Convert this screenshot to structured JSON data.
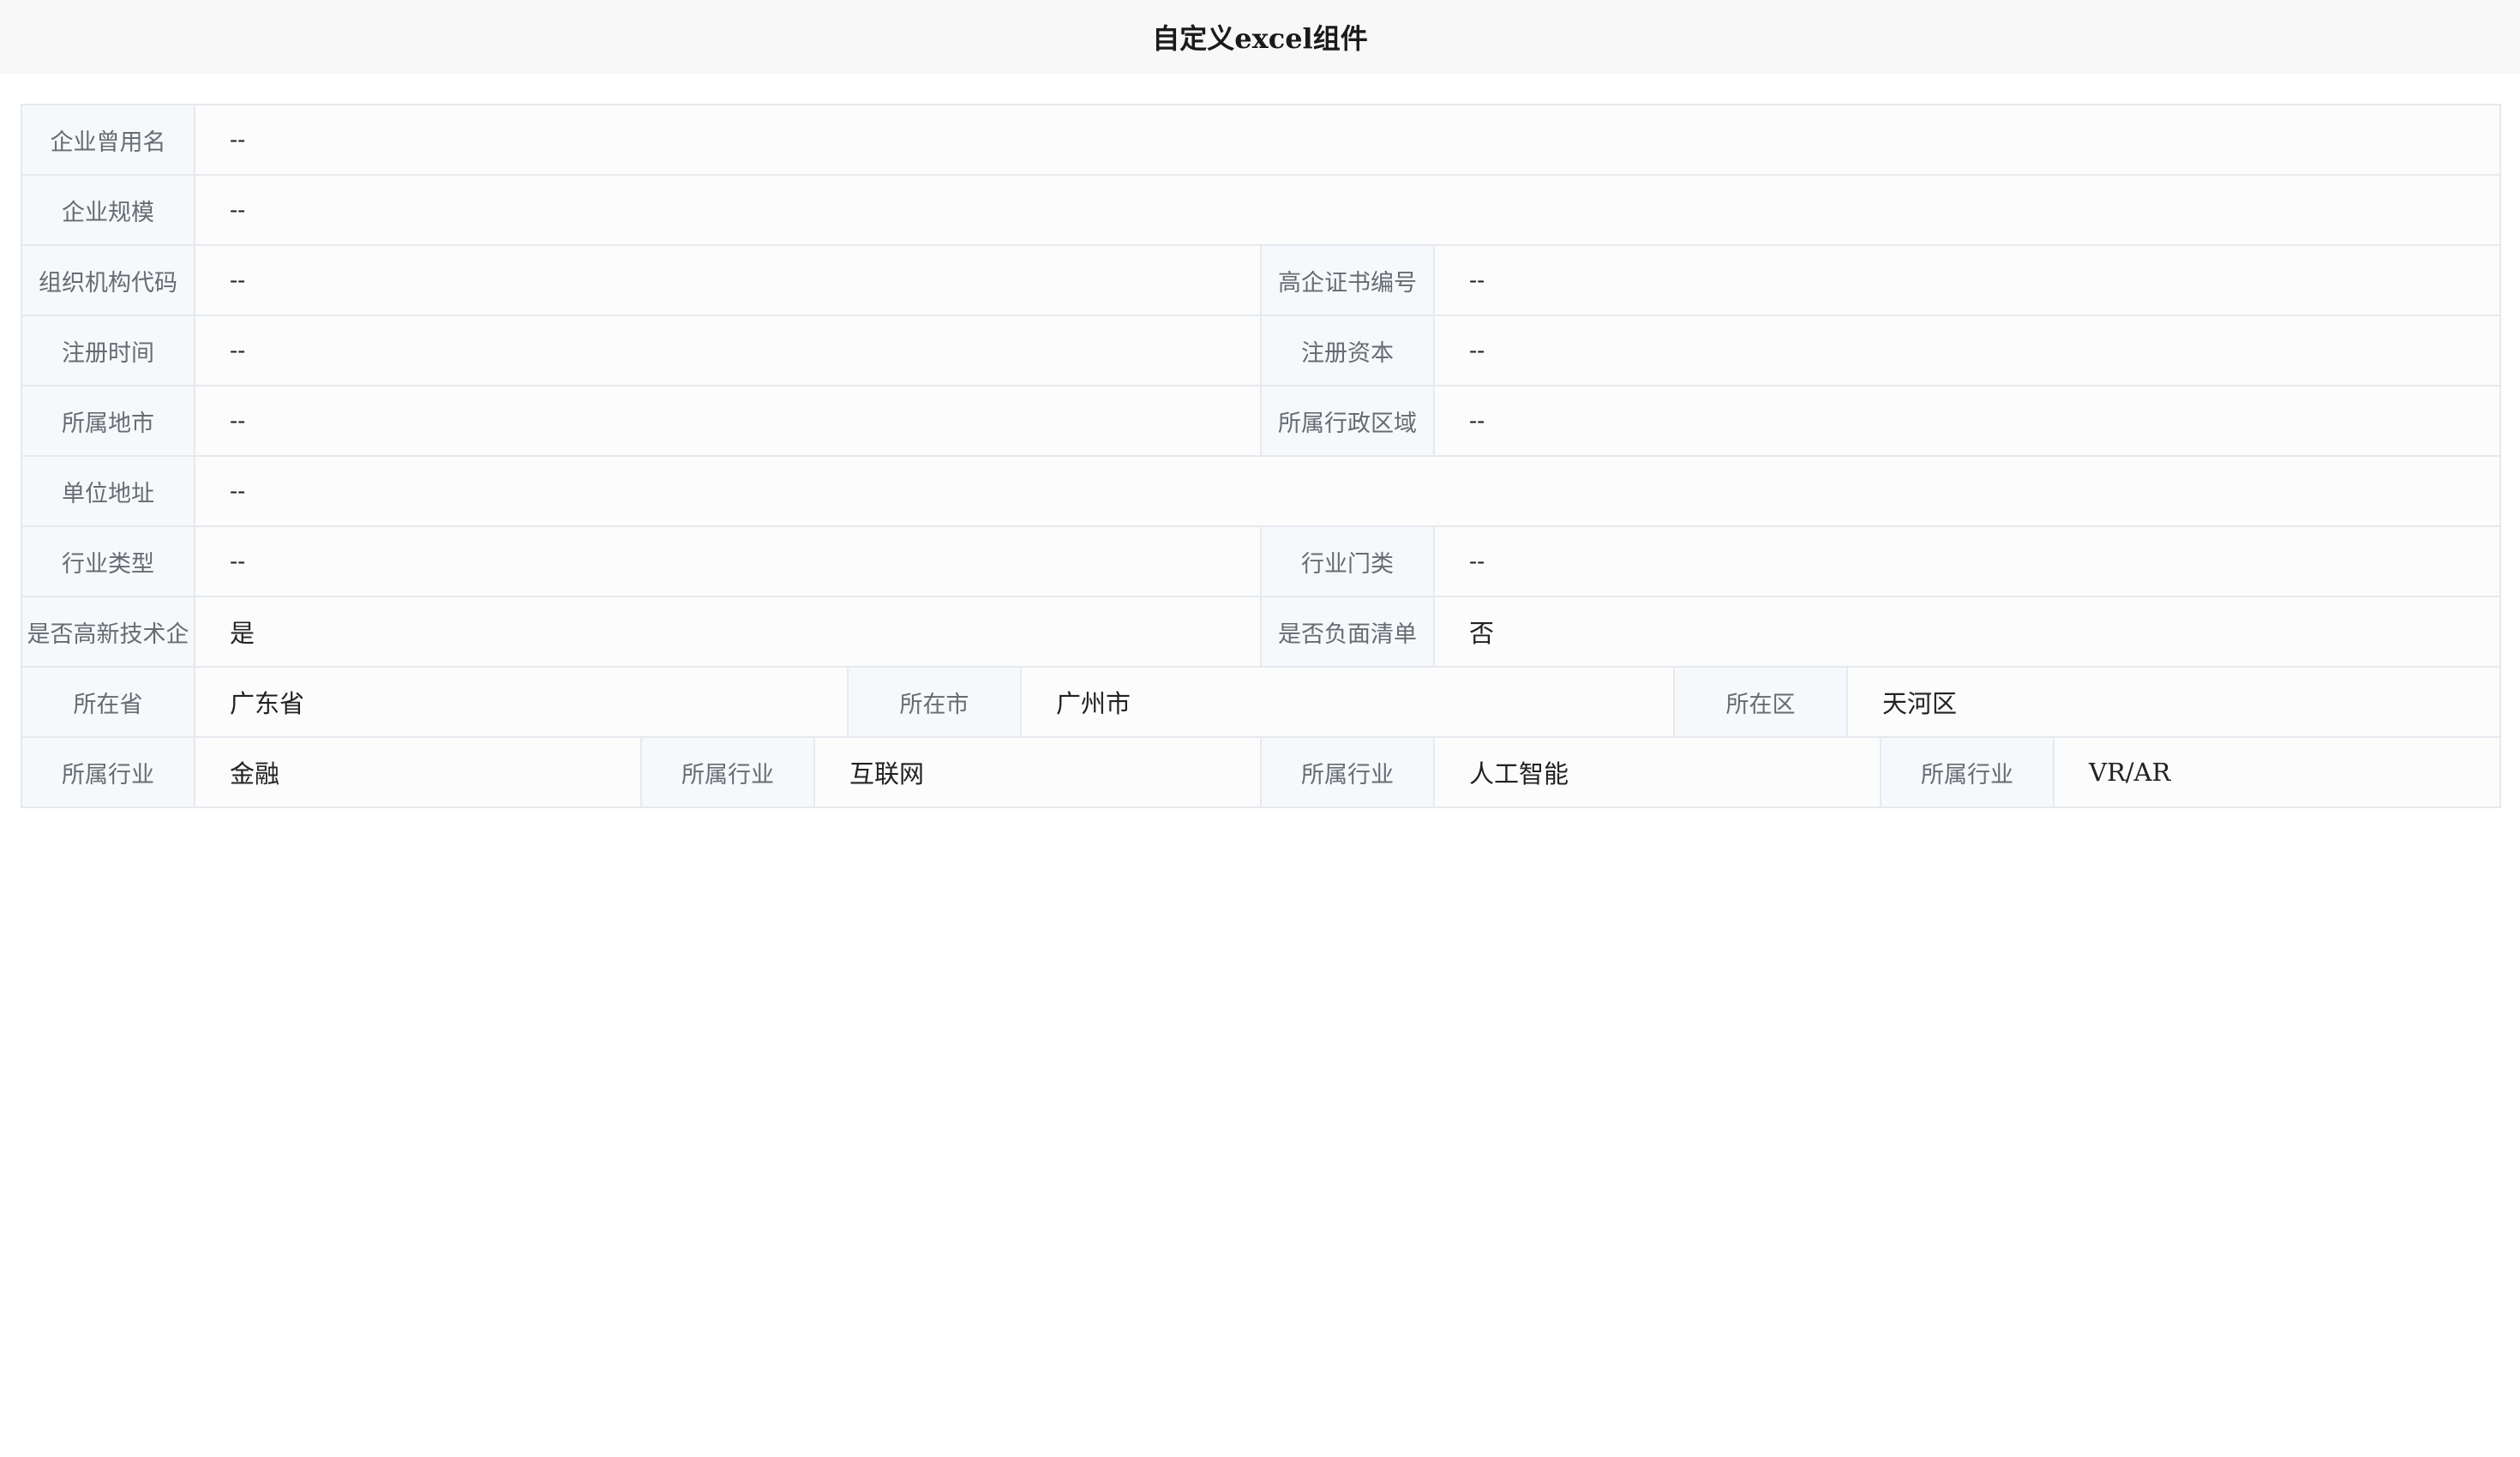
{
  "header": {
    "title": "自定义excel组件"
  },
  "rows": [
    {
      "cells": [
        {
          "label": "企业曾用名",
          "value": "--"
        }
      ]
    },
    {
      "cells": [
        {
          "label": "企业规模",
          "value": "--"
        }
      ]
    },
    {
      "cells": [
        {
          "label": "组织机构代码",
          "value": "--"
        },
        {
          "label": "高企证书编号",
          "value": "--"
        }
      ]
    },
    {
      "cells": [
        {
          "label": "注册时间",
          "value": "--"
        },
        {
          "label": "注册资本",
          "value": "--"
        }
      ]
    },
    {
      "cells": [
        {
          "label": "所属地市",
          "value": "--"
        },
        {
          "label": "所属行政区域",
          "value": "--"
        }
      ]
    },
    {
      "cells": [
        {
          "label": "单位地址",
          "value": "--"
        }
      ]
    },
    {
      "cells": [
        {
          "label": "行业类型",
          "value": "--"
        },
        {
          "label": "行业门类",
          "value": "--"
        }
      ]
    },
    {
      "cells": [
        {
          "label": "是否高新技术企",
          "value": "是"
        },
        {
          "label": "是否负面清单",
          "value": "否"
        }
      ]
    },
    {
      "cells": [
        {
          "label": "所在省",
          "value": "广东省"
        },
        {
          "label": "所在市",
          "value": "广州市"
        },
        {
          "label": "所在区",
          "value": "天河区"
        }
      ]
    },
    {
      "cells": [
        {
          "label": "所属行业",
          "value": "金融"
        },
        {
          "label": "所属行业",
          "value": "互联网"
        },
        {
          "label": "所属行业",
          "value": "人工智能"
        },
        {
          "label": "所属行业",
          "value": "VR/AR"
        }
      ]
    }
  ]
}
